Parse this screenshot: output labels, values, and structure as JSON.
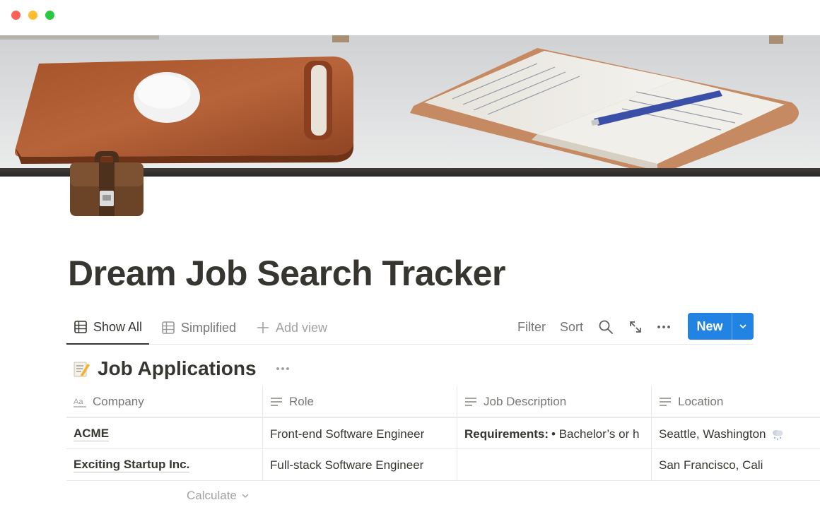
{
  "window": {
    "controls": [
      "close",
      "minimize",
      "zoom"
    ]
  },
  "page": {
    "icon": "briefcase-icon",
    "title": "Dream Job Search Tracker"
  },
  "views": {
    "tabs": [
      {
        "label": "Show All",
        "icon": "table-icon",
        "active": true
      },
      {
        "label": "Simplified",
        "icon": "table-icon",
        "active": false
      }
    ],
    "add_view": "Add view"
  },
  "toolbar": {
    "filter": "Filter",
    "sort": "Sort",
    "new": "New",
    "new_color": "#2383e2"
  },
  "database": {
    "emoji": "memo-icon",
    "title": "Job Applications",
    "columns": [
      {
        "label": "Company",
        "icon": "title-property-icon"
      },
      {
        "label": "Role",
        "icon": "text-property-icon"
      },
      {
        "label": "Job Description",
        "icon": "text-property-icon"
      },
      {
        "label": "Location",
        "icon": "text-property-icon"
      }
    ],
    "rows": [
      {
        "company": "ACME",
        "role": "Front-end Software Engineer",
        "description_bold": "Requirements:",
        "description_rest": "• Bachelor’s or h",
        "location": "Seattle, Washington",
        "location_icon": "snow-cloud-icon"
      },
      {
        "company": "Exciting Startup Inc.",
        "role": "Full-stack Software Engineer",
        "description_bold": "",
        "description_rest": "",
        "location": "San Francisco, Cali"
      }
    ],
    "calculate": "Calculate"
  }
}
